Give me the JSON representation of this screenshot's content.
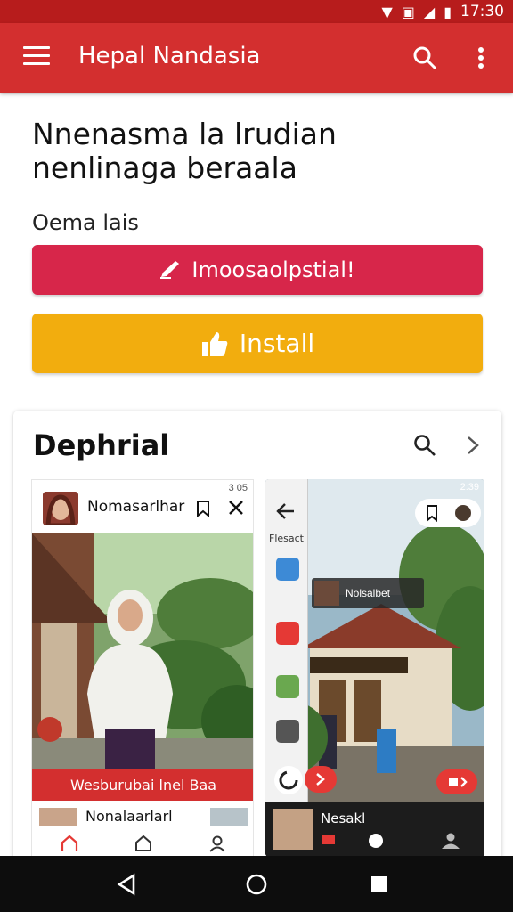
{
  "status_bar": {
    "time": "17:30"
  },
  "app_bar": {
    "title": "Hepal Nandasia"
  },
  "headline": "Nnenasma la lrudian nenlinaga beraala",
  "subhead": "Oema lais",
  "buttons": {
    "primary_label": "Imoosaolpstial!",
    "install_label": "Install"
  },
  "card": {
    "title": "Dephrial",
    "shot1": {
      "status": "3 05",
      "name": "Nomasarlhar",
      "caption": "Wesburubai lnel Baa",
      "row_name": "Nonalaarlarl"
    },
    "shot2": {
      "status": "2:39",
      "drawer_label": "Flesact",
      "tag_text": "Nolsalbet",
      "bottom_name": "Nesakl"
    }
  },
  "colors": {
    "app_bar": "#d32f2f",
    "primary_button": "#d7264a",
    "install_button": "#f2ad0e"
  },
  "icons": [
    "menu-icon",
    "search-icon",
    "more-vert-icon",
    "pen-icon",
    "thumbs-up-icon",
    "chevron-right-icon",
    "back-icon",
    "home-icon",
    "recents-icon"
  ]
}
